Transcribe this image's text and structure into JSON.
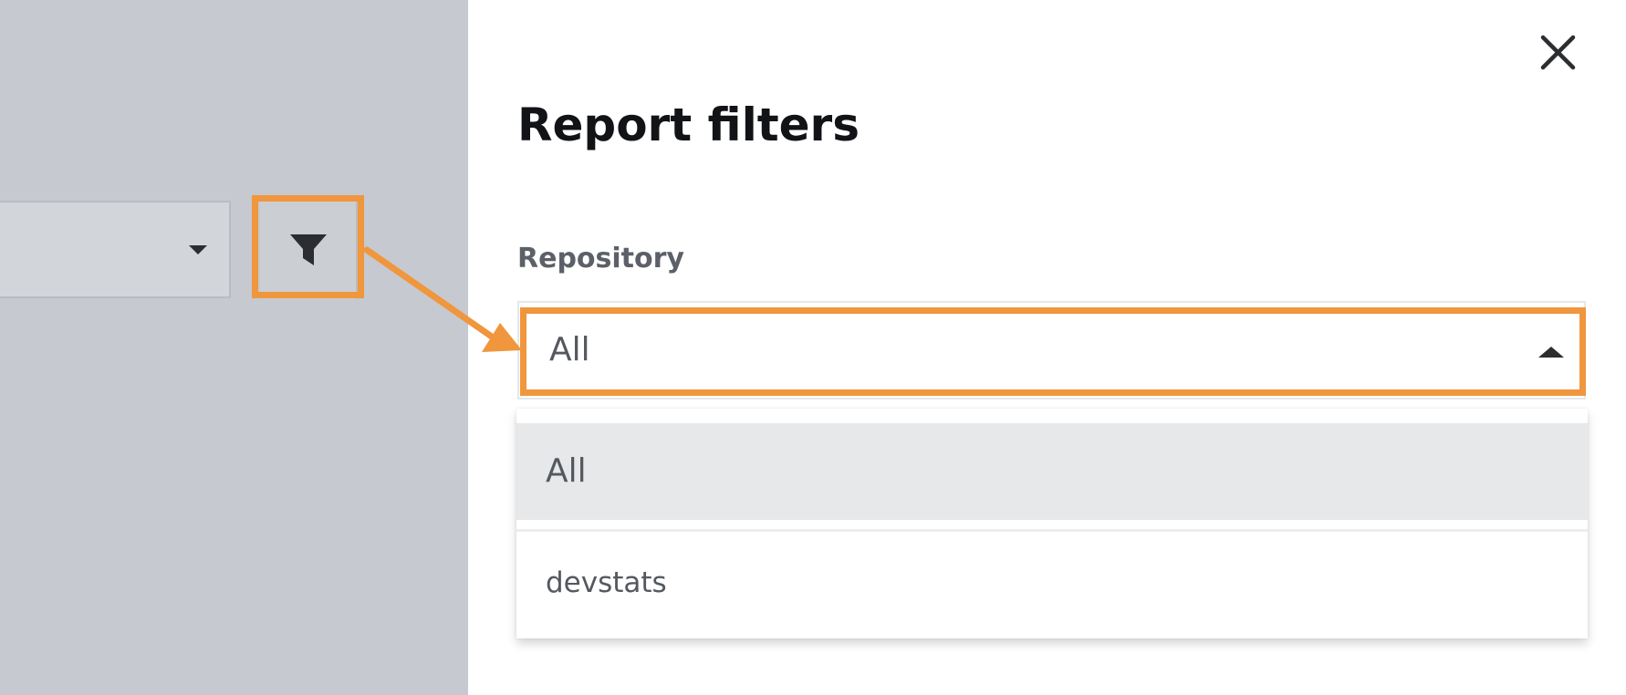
{
  "colors": {
    "backdrop": "#c6c9cf",
    "annotation": "#f0963d",
    "selected_option_bg": "#e7e8ea",
    "title_text": "#111316",
    "label_text": "#5c6068"
  },
  "icons": {
    "filter": "filter-funnel-icon",
    "close": "close-icon",
    "dropdown_caret": "caret-down-icon",
    "select_caret": "caret-up-icon"
  },
  "drawer": {
    "title": "Report filters",
    "repository": {
      "label": "Repository",
      "selected_value": "All",
      "expanded": true,
      "options": [
        {
          "label": "All",
          "selected": true
        },
        {
          "label": "devstats",
          "selected": false
        }
      ]
    }
  }
}
